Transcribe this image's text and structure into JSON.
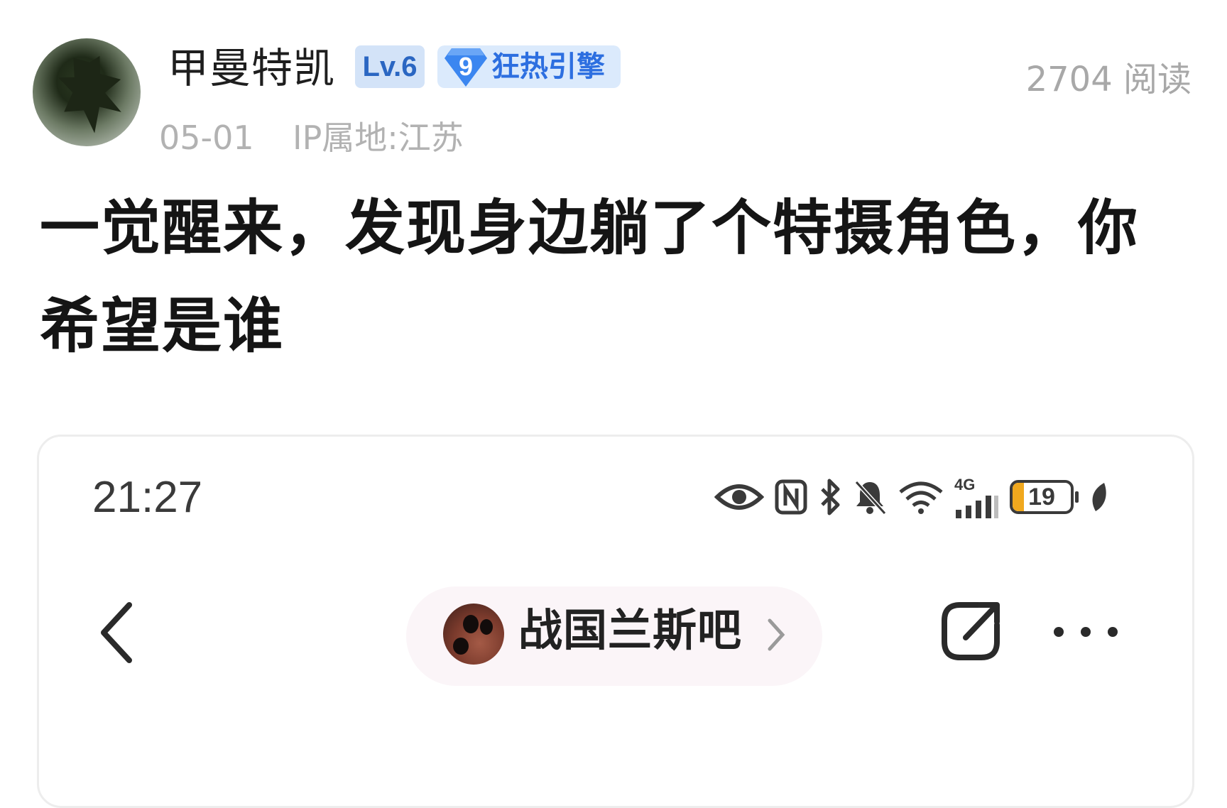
{
  "post": {
    "author": {
      "name": "甲曼特凯",
      "level": "Lv.6",
      "fan_badge": {
        "number": "9",
        "label": "狂热引擎"
      }
    },
    "read_count": "2704 阅读",
    "date": "05-01",
    "ip_location": "IP属地:江苏",
    "title": "一觉醒来，发现身边躺了个特摄角色，你希望是谁"
  },
  "screenshot": {
    "status_bar": {
      "time": "21:27",
      "network": "4G",
      "battery_level": "19",
      "battery_percent": 19,
      "icons": [
        "eye-icon",
        "nfc-icon",
        "bluetooth-icon",
        "mute-bell-icon",
        "wifi-icon",
        "signal-icon",
        "battery-icon",
        "leaf-icon"
      ]
    },
    "nav": {
      "forum_name": "战国兰斯吧"
    }
  },
  "colors": {
    "level_badge_bg": "#d3e3f8",
    "level_badge_text": "#2a66c2",
    "fan_badge_bg": "#dbeafc",
    "fan_badge_text": "#2d6fe0",
    "meta_text": "#b2b2b2",
    "battery_fill": "#f0a81e"
  }
}
